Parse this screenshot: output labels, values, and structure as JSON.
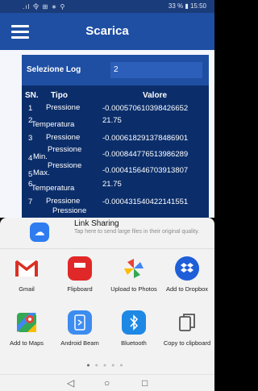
{
  "status": {
    "left": ".ıl 令 ⊞ ∗ ⚲",
    "right": "33 % ▮ 15:50"
  },
  "app": {
    "title": "Scarica"
  },
  "selector": {
    "label": "Selezione Log",
    "value": "2"
  },
  "table": {
    "headers": {
      "sn": "SN.",
      "tipo": "Tipo",
      "valore": "Valore"
    },
    "rows": [
      {
        "sn": "1",
        "tipo": "Pressione",
        "valore": "-0.000570610398426652"
      },
      {
        "sn": "2",
        "tipo": "Temperatura",
        "valore": "21.75"
      },
      {
        "sn": "3",
        "tipo": "Pressione",
        "valore": "-0.000618291378486901"
      },
      {
        "sn": "4",
        "tipo": "Pressione Min.",
        "valore": "-0.000844776513986289"
      },
      {
        "sn": "5",
        "tipo": "Pressione Max.",
        "valore": "-0.000415646703913807"
      },
      {
        "sn": "6",
        "tipo": "Temperatura",
        "valore": "21.75"
      },
      {
        "sn": "7",
        "tipo": "Pressione",
        "valore": "-0.000431540422141551"
      },
      {
        "sn": "",
        "tipo": "Pressione",
        "valore": ""
      }
    ]
  },
  "share": {
    "link_title": "Link Sharing",
    "link_sub": "Tap here to send large files in their original quality.",
    "apps": [
      {
        "label": "Gmail",
        "icon": "gmail-icon",
        "color": "#ffffff"
      },
      {
        "label": "Flipboard",
        "icon": "flipboard-icon",
        "color": "#e12828"
      },
      {
        "label": "Upload to Photos",
        "icon": "photos-icon",
        "color": "#ffffff"
      },
      {
        "label": "Add to Dropbox",
        "icon": "dropbox-icon",
        "color": "#1e5fd9"
      },
      {
        "label": "Add to Maps",
        "icon": "maps-icon",
        "color": "#ffffff"
      },
      {
        "label": "Android Beam",
        "icon": "android-beam-icon",
        "color": "#3d8cf0"
      },
      {
        "label": "Bluetooth",
        "icon": "bluetooth-icon",
        "color": "#1e88e5"
      },
      {
        "label": "Copy to clipboard",
        "icon": "clipboard-icon",
        "color": "#ffffff"
      }
    ]
  },
  "nav": {
    "back": "◁",
    "home": "○",
    "recents": "□"
  }
}
